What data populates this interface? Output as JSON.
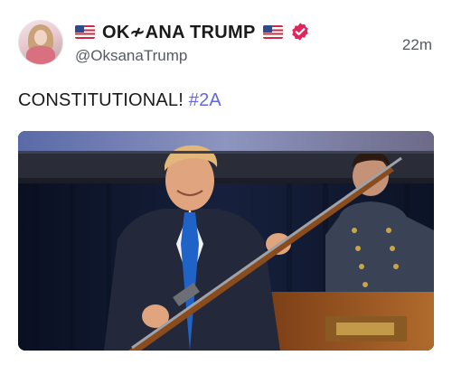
{
  "author": {
    "display_name": "OK≁ANA TRUMP",
    "handle": "@OksanaTrump",
    "verified": true,
    "avatar_icon": "profile-photo"
  },
  "post": {
    "time": "22m",
    "text": "CONSTITUTIONAL! ",
    "hashtag": "#2A",
    "media_icon": "photo"
  },
  "colors": {
    "hashtag": "#6467e0",
    "verified_badge": "#e0245e",
    "muted_text": "#555a60"
  }
}
